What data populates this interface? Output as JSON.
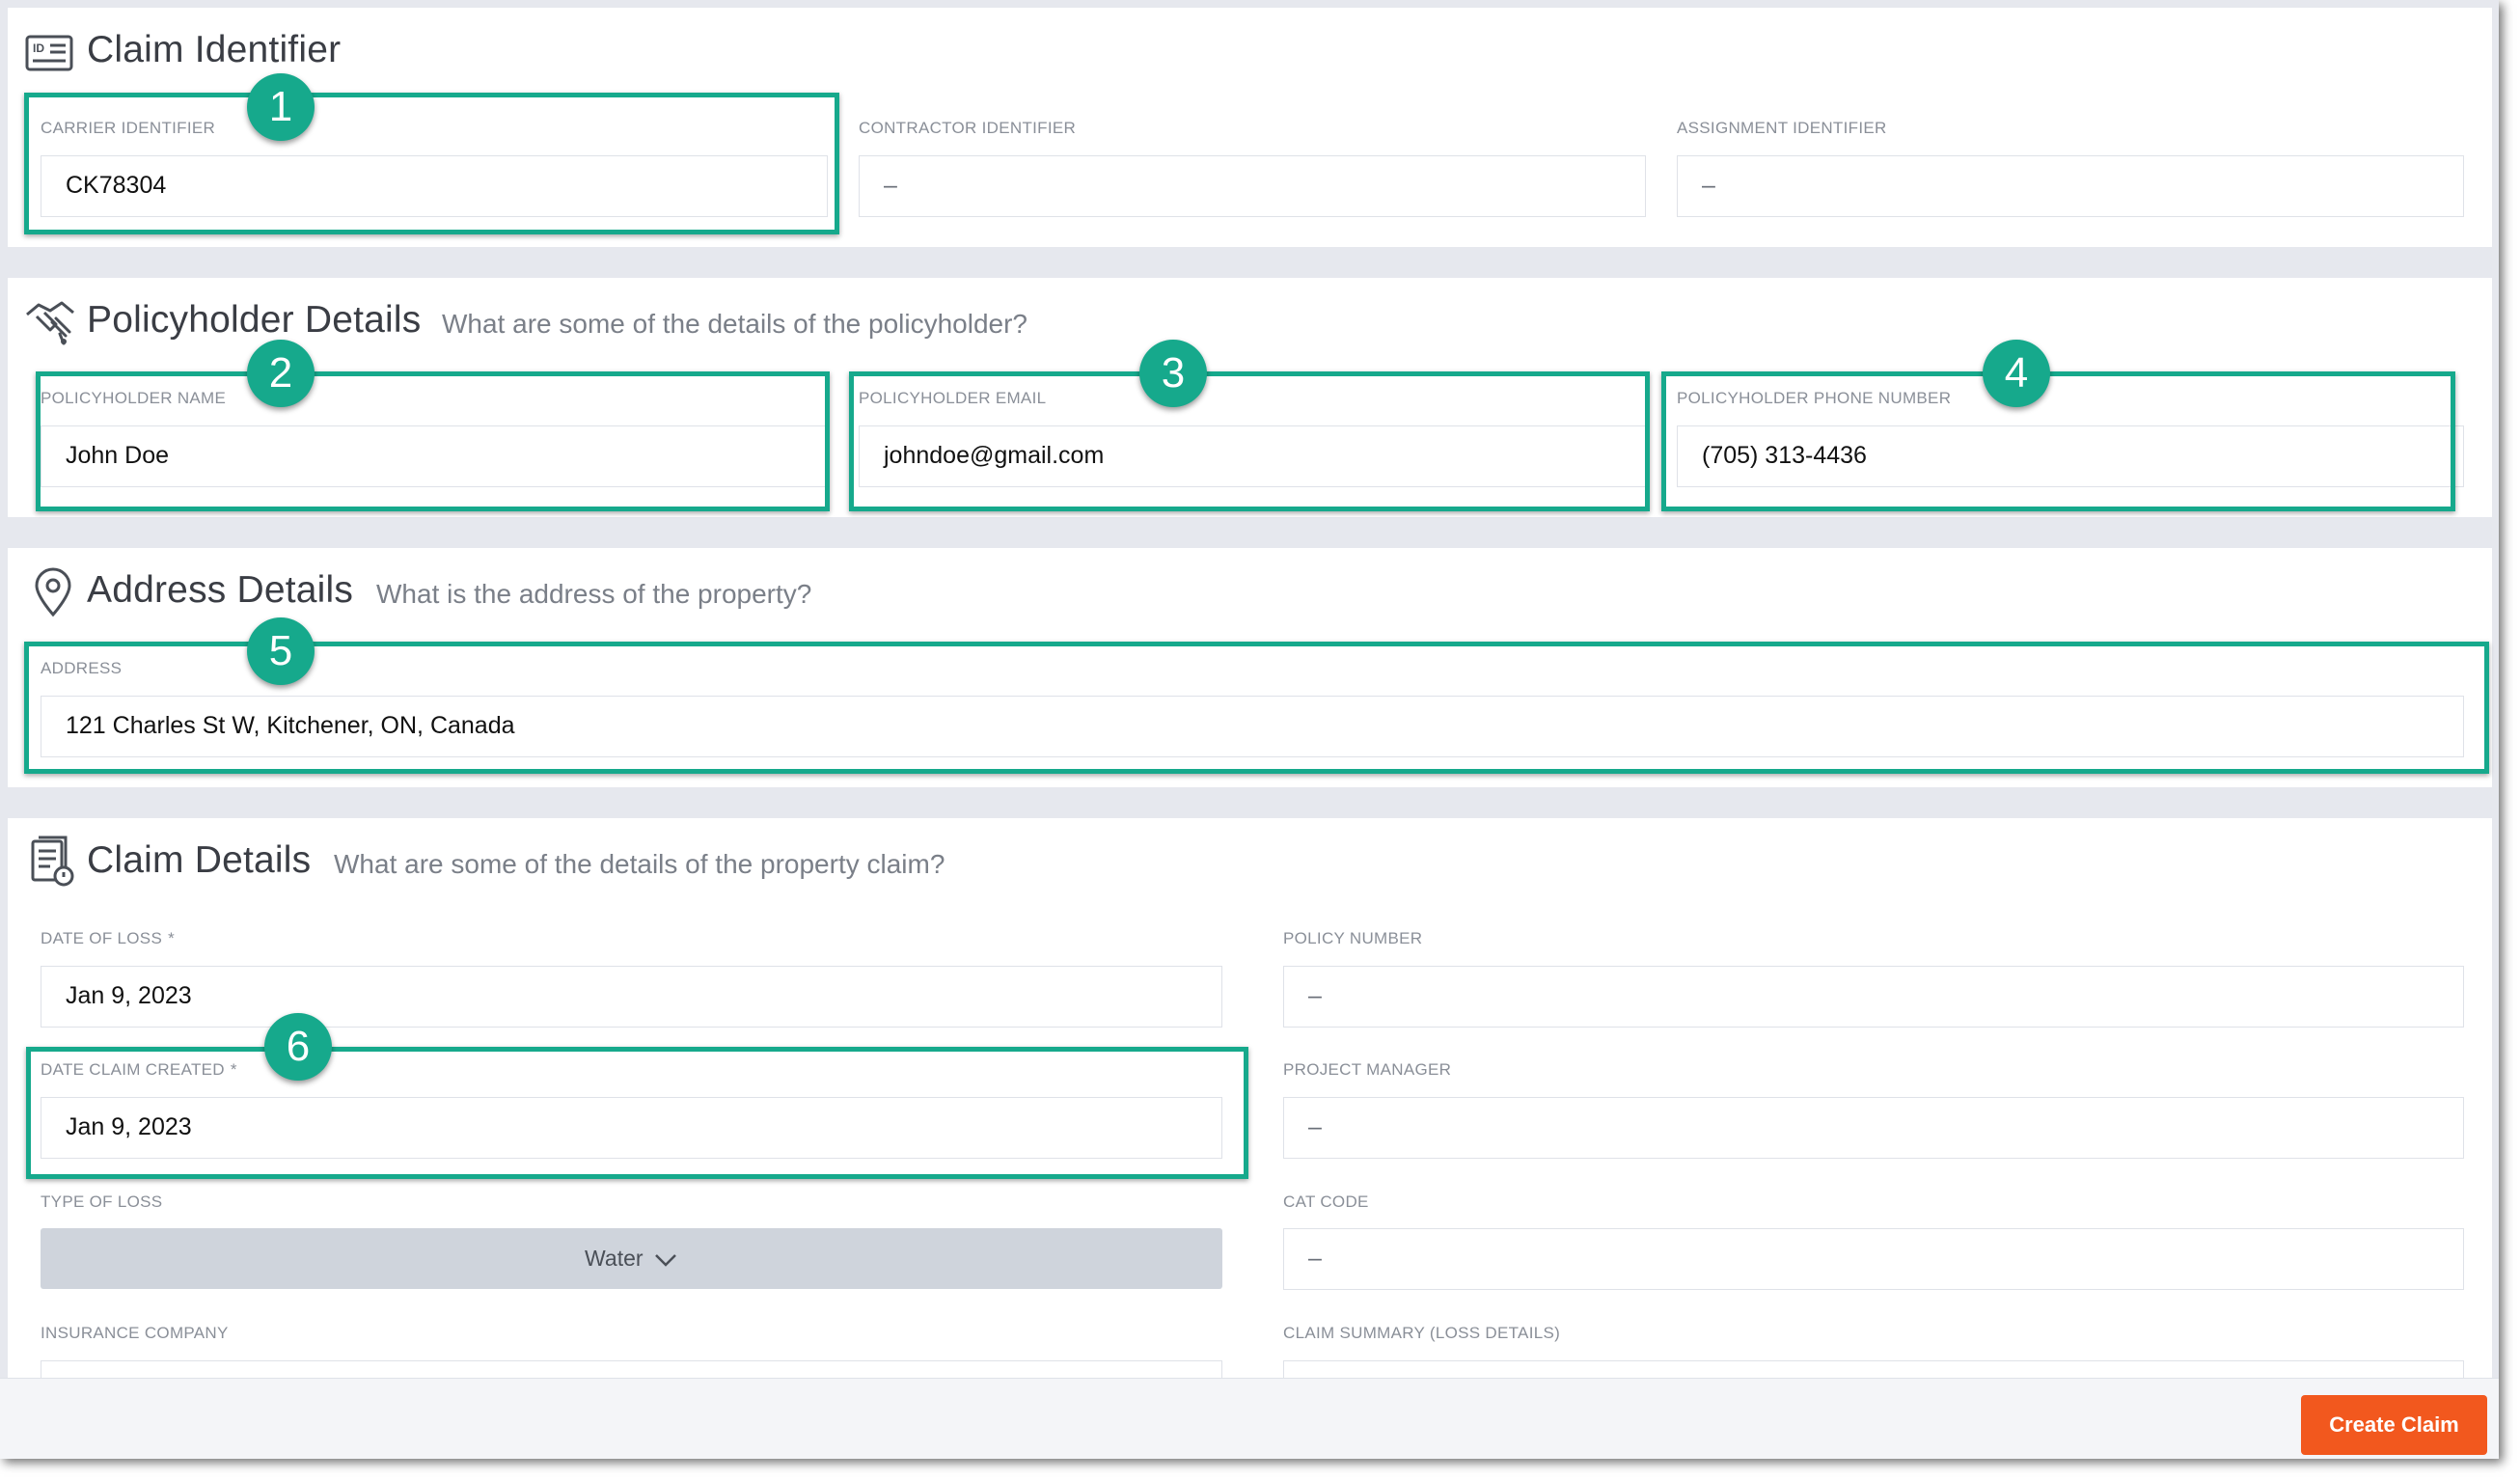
{
  "sections": {
    "claim_identifier": {
      "title": "Claim Identifier",
      "icon": "id-card-icon",
      "fields": {
        "carrier": {
          "label": "CARRIER IDENTIFIER",
          "value": "CK78304"
        },
        "contractor": {
          "label": "CONTRACTOR IDENTIFIER",
          "value": "–"
        },
        "assignment": {
          "label": "ASSIGNMENT IDENTIFIER",
          "value": "–"
        }
      }
    },
    "policyholder": {
      "title": "Policyholder Details",
      "subtitle": "What are some of the details of the policyholder?",
      "icon": "handshake-icon",
      "fields": {
        "name": {
          "label": "POLICYHOLDER NAME",
          "value": "John Doe"
        },
        "email": {
          "label": "POLICYHOLDER EMAIL",
          "value": "johndoe@gmail.com"
        },
        "phone": {
          "label": "POLICYHOLDER PHONE NUMBER",
          "value": "(705) 313-4436"
        }
      }
    },
    "address": {
      "title": "Address Details",
      "subtitle": "What is the address of the property?",
      "icon": "map-pin-icon",
      "fields": {
        "address": {
          "label": "ADDRESS",
          "value": "121 Charles St W, Kitchener, ON, Canada"
        }
      }
    },
    "claim_details": {
      "title": "Claim Details",
      "subtitle": "What are some of the details of the property claim?",
      "icon": "document-icon",
      "fields": {
        "date_of_loss": {
          "label": "DATE OF LOSS",
          "required": "*",
          "value": "Jan 9, 2023"
        },
        "date_claim_created": {
          "label": "DATE CLAIM CREATED",
          "required": "*",
          "value": "Jan 9, 2023"
        },
        "type_of_loss": {
          "label": "TYPE OF LOSS",
          "value": "Water"
        },
        "insurance_company": {
          "label": "INSURANCE COMPANY",
          "value": ""
        },
        "policy_number": {
          "label": "POLICY NUMBER",
          "value": "–"
        },
        "project_manager": {
          "label": "PROJECT MANAGER",
          "value": "–"
        },
        "cat_code": {
          "label": "CAT CODE",
          "value": "–"
        },
        "claim_summary": {
          "label": "CLAIM SUMMARY (LOSS DETAILS)",
          "value": ""
        }
      }
    }
  },
  "annotations": [
    "1",
    "2",
    "3",
    "4",
    "5",
    "6"
  ],
  "footer": {
    "create_claim_label": "Create Claim"
  },
  "colors": {
    "highlight": "#16a98c",
    "primary_button": "#f2581e",
    "select_button": "#cfd4dc",
    "page_background": "#e6e8ee"
  }
}
